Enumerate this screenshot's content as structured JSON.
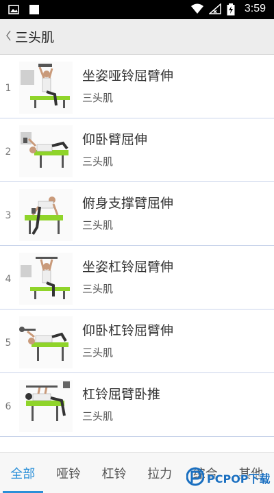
{
  "status_bar": {
    "time": "3:59",
    "icons": [
      "image-icon",
      "photo-icon",
      "wifi-icon",
      "signal-icon",
      "battery-charging-icon"
    ]
  },
  "header": {
    "back_icon": "chevron-left-icon",
    "title": "三头肌"
  },
  "exercises": [
    {
      "index": "1",
      "name": "坐姿哑铃屈臂伸",
      "muscle": "三头肌"
    },
    {
      "index": "2",
      "name": "仰卧臂屈伸",
      "muscle": "三头肌"
    },
    {
      "index": "3",
      "name": "俯身支撑臂屈伸",
      "muscle": "三头肌"
    },
    {
      "index": "4",
      "name": "坐姿杠铃屈臂伸",
      "muscle": "三头肌"
    },
    {
      "index": "5",
      "name": "仰卧杠铃屈臂伸",
      "muscle": "三头肌"
    },
    {
      "index": "6",
      "name": "杠铃屈臂卧推",
      "muscle": "三头肌"
    }
  ],
  "tabs": {
    "all": "全部",
    "dumbbell": "哑铃",
    "barbell": "杠铃",
    "cable": "拉力",
    "combined": "综合",
    "other": "其他"
  },
  "active_tab": "all",
  "watermark": {
    "text": "PCPOP下载"
  },
  "colors": {
    "accent": "#2a8fd8",
    "bench": "#8fd42a",
    "divider": "#c8d3ea"
  }
}
